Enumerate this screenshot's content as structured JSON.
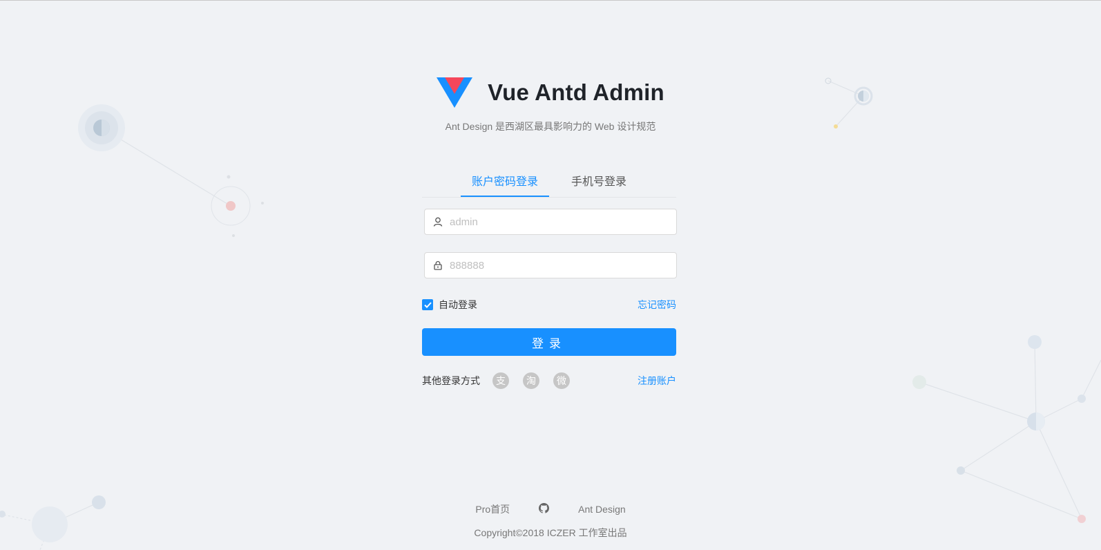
{
  "app": {
    "title": "Vue Antd Admin",
    "description": "Ant Design 是西湖区最具影响力的 Web 设计规范"
  },
  "tabs": [
    {
      "label": "账户密码登录",
      "active": true
    },
    {
      "label": "手机号登录",
      "active": false
    }
  ],
  "form": {
    "username_placeholder": "admin",
    "password_placeholder": "888888",
    "auto_login_label": "自动登录",
    "auto_login_checked": true,
    "forgot_label": "忘记密码",
    "submit_label": "登录"
  },
  "other": {
    "label": "其他登录方式",
    "icons": [
      "alipay-icon",
      "taobao-icon",
      "weibo-icon"
    ],
    "icon_glyphs": [
      "支",
      "淘",
      "微"
    ],
    "register_label": "注册账户"
  },
  "footer": {
    "links": [
      "Pro首页",
      "github-icon",
      "Ant Design"
    ],
    "pro_label": "Pro首页",
    "ant_label": "Ant Design",
    "copyright": "Copyright©2018 ICZER 工作室出品"
  },
  "colors": {
    "primary": "#1890ff",
    "background": "#f0f2f5",
    "logo_blue": "#1890ff",
    "logo_red": "#f5475b"
  }
}
